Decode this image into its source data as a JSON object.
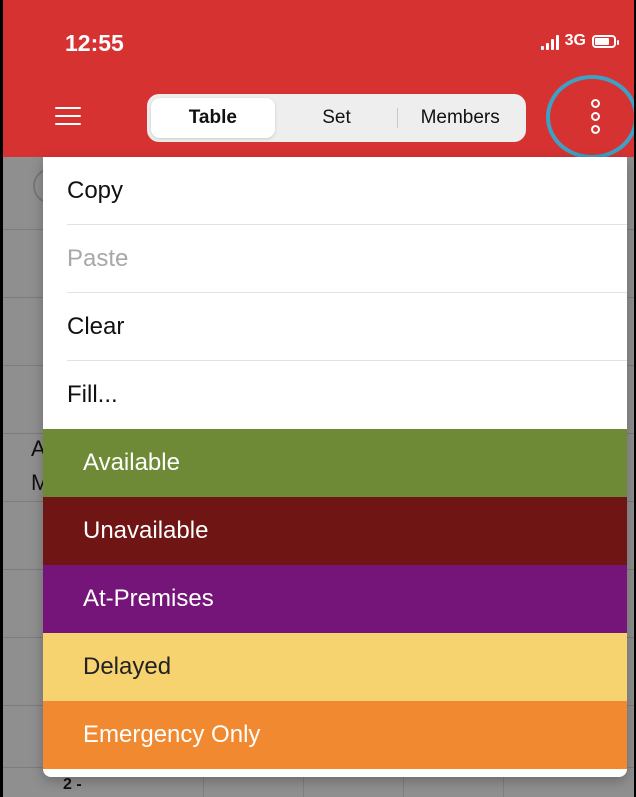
{
  "status_bar": {
    "time": "12:55",
    "network": "3G"
  },
  "header": {
    "menu_icon": "hamburger-icon",
    "tabs": [
      {
        "label": "Table",
        "active": true
      },
      {
        "label": "Set",
        "active": false
      },
      {
        "label": "Members",
        "active": false
      }
    ],
    "more_icon": "vertical-dots-icon"
  },
  "background": {
    "text_a": "A",
    "text_m": "M",
    "row_label": "2 -"
  },
  "menu": {
    "items": [
      {
        "label": "Copy",
        "enabled": true
      },
      {
        "label": "Paste",
        "enabled": false
      },
      {
        "label": "Clear",
        "enabled": true
      },
      {
        "label": "Fill...",
        "enabled": true
      }
    ],
    "fill_options": [
      {
        "label": "Available",
        "bg": "#6e8a36",
        "fg": "#ffffff"
      },
      {
        "label": "Unavailable",
        "bg": "#6f1615",
        "fg": "#ffffff"
      },
      {
        "label": "At-Premises",
        "bg": "#761579",
        "fg": "#ffffff"
      },
      {
        "label": "Delayed",
        "bg": "#f6d36e",
        "fg": "#222222"
      },
      {
        "label": "Emergency Only",
        "bg": "#f08930",
        "fg": "#ffffff"
      }
    ]
  },
  "colors": {
    "header_bg": "#d63232",
    "highlight_ring": "#3ea0c4"
  }
}
